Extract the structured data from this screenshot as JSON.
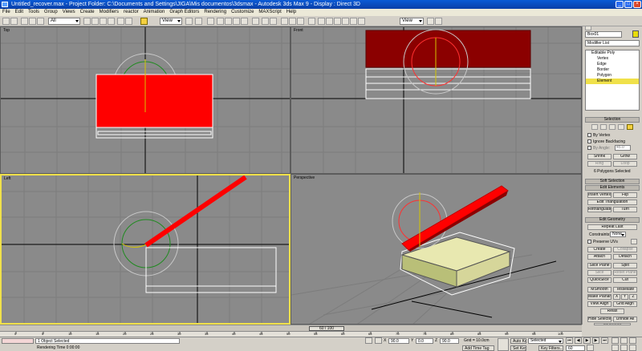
{
  "window": {
    "title": "Untitled_recover.max - Project Folder: C:\\Documents and Settings\\JIGA\\Mis documentos\\3dsmax - Autodesk 3ds Max 9 - Display : Direct 3D"
  },
  "menu": [
    "File",
    "Edit",
    "Tools",
    "Group",
    "Views",
    "Create",
    "Modifiers",
    "reactor",
    "Animation",
    "Graph Editors",
    "Rendering",
    "Customize",
    "MAXScript",
    "Help"
  ],
  "toolbar": {
    "selection_filter": "All",
    "ref_coord_1": "View",
    "ref_coord_2": "View"
  },
  "viewports": {
    "top": "Top",
    "front": "Front",
    "left": "Left",
    "perspective": "Perspective"
  },
  "command_panel": {
    "object_name": "Box01",
    "modifier_list": "Modifier List",
    "stack": [
      "Editable Poly",
      "Vertex",
      "Edge",
      "Border",
      "Polygon",
      "Element"
    ],
    "selection": {
      "title": "Selection",
      "by_vertex": "By Vertex",
      "ignore_backfacing": "Ignore Backfacing",
      "by_angle": "By Angle:",
      "angle_value": "45.0",
      "shrink": "Shrink",
      "grow": "Grow",
      "ring": "Ring",
      "loop": "Loop",
      "status": "6 Polygons Selected"
    },
    "soft_selection": "Soft Selection",
    "edit_elements": {
      "title": "Edit Elements",
      "insert_vertex": "Insert Vertex",
      "flip": "Flip",
      "edit_triangulation": "Edit Triangulation",
      "retriangulate": "Retriangulate",
      "turn": "Turn"
    },
    "edit_geometry": {
      "title": "Edit Geometry",
      "repeat_last": "Repeat Last",
      "constraints": "Constraints:",
      "constraints_value": "None",
      "preserve_uvs": "Preserve UVs",
      "create": "Create",
      "collapse": "Collapse",
      "attach": "Attach",
      "detach": "Detach",
      "slice_plane": "Slice Plane",
      "split": "Split",
      "slice": "Slice",
      "reset_plane": "Reset Plane",
      "quickslice": "QuickSlice",
      "cut": "Cut",
      "msmooth": "MSmooth",
      "tessellate": "Tessellate",
      "make_planar": "Make Planar",
      "x": "X",
      "y": "Y",
      "z": "Z",
      "view_align": "View Align",
      "grid_align": "Grid Align",
      "relax": "Relax",
      "hide_selected": "Hide Selected",
      "unhide_all": "Unhide All",
      "hide_unselected": "Hide Unselected"
    }
  },
  "time": {
    "slider": "60 / 100",
    "ticks": [
      "0",
      "5",
      "10",
      "15",
      "20",
      "25",
      "30",
      "35",
      "40",
      "45",
      "50",
      "55",
      "60",
      "65",
      "70",
      "75",
      "80",
      "85",
      "90",
      "95",
      "100"
    ]
  },
  "status": {
    "selection": "1 Object Selected",
    "prompt": "Rendering Time  0:00:00",
    "x": "90.0",
    "y": "0.0",
    "z": "90.0",
    "grid": "Grid = 10.0cm",
    "add_time_tag": "Add Time Tag",
    "auto_key": "Auto Key",
    "set_key": "Set Key",
    "key_mode": "Selected",
    "key_filters": "Key Filters...",
    "frame": "60"
  }
}
